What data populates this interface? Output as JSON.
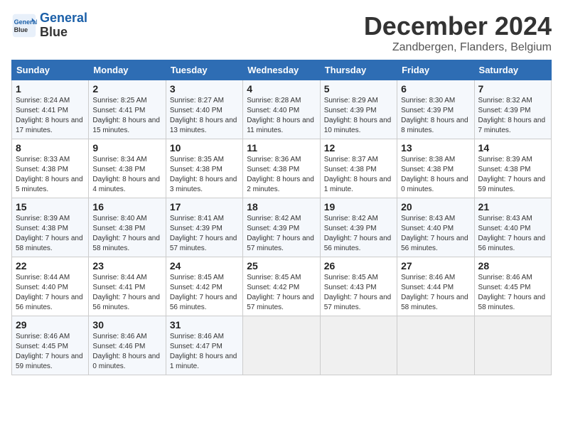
{
  "header": {
    "logo_line1": "General",
    "logo_line2": "Blue",
    "month_title": "December 2024",
    "location": "Zandbergen, Flanders, Belgium"
  },
  "weekdays": [
    "Sunday",
    "Monday",
    "Tuesday",
    "Wednesday",
    "Thursday",
    "Friday",
    "Saturday"
  ],
  "weeks": [
    [
      {
        "day": "1",
        "info": "Sunrise: 8:24 AM\nSunset: 4:41 PM\nDaylight: 8 hours and 17 minutes."
      },
      {
        "day": "2",
        "info": "Sunrise: 8:25 AM\nSunset: 4:41 PM\nDaylight: 8 hours and 15 minutes."
      },
      {
        "day": "3",
        "info": "Sunrise: 8:27 AM\nSunset: 4:40 PM\nDaylight: 8 hours and 13 minutes."
      },
      {
        "day": "4",
        "info": "Sunrise: 8:28 AM\nSunset: 4:40 PM\nDaylight: 8 hours and 11 minutes."
      },
      {
        "day": "5",
        "info": "Sunrise: 8:29 AM\nSunset: 4:39 PM\nDaylight: 8 hours and 10 minutes."
      },
      {
        "day": "6",
        "info": "Sunrise: 8:30 AM\nSunset: 4:39 PM\nDaylight: 8 hours and 8 minutes."
      },
      {
        "day": "7",
        "info": "Sunrise: 8:32 AM\nSunset: 4:39 PM\nDaylight: 8 hours and 7 minutes."
      }
    ],
    [
      {
        "day": "8",
        "info": "Sunrise: 8:33 AM\nSunset: 4:38 PM\nDaylight: 8 hours and 5 minutes."
      },
      {
        "day": "9",
        "info": "Sunrise: 8:34 AM\nSunset: 4:38 PM\nDaylight: 8 hours and 4 minutes."
      },
      {
        "day": "10",
        "info": "Sunrise: 8:35 AM\nSunset: 4:38 PM\nDaylight: 8 hours and 3 minutes."
      },
      {
        "day": "11",
        "info": "Sunrise: 8:36 AM\nSunset: 4:38 PM\nDaylight: 8 hours and 2 minutes."
      },
      {
        "day": "12",
        "info": "Sunrise: 8:37 AM\nSunset: 4:38 PM\nDaylight: 8 hours and 1 minute."
      },
      {
        "day": "13",
        "info": "Sunrise: 8:38 AM\nSunset: 4:38 PM\nDaylight: 8 hours and 0 minutes."
      },
      {
        "day": "14",
        "info": "Sunrise: 8:39 AM\nSunset: 4:38 PM\nDaylight: 7 hours and 59 minutes."
      }
    ],
    [
      {
        "day": "15",
        "info": "Sunrise: 8:39 AM\nSunset: 4:38 PM\nDaylight: 7 hours and 58 minutes."
      },
      {
        "day": "16",
        "info": "Sunrise: 8:40 AM\nSunset: 4:38 PM\nDaylight: 7 hours and 58 minutes."
      },
      {
        "day": "17",
        "info": "Sunrise: 8:41 AM\nSunset: 4:39 PM\nDaylight: 7 hours and 57 minutes."
      },
      {
        "day": "18",
        "info": "Sunrise: 8:42 AM\nSunset: 4:39 PM\nDaylight: 7 hours and 57 minutes."
      },
      {
        "day": "19",
        "info": "Sunrise: 8:42 AM\nSunset: 4:39 PM\nDaylight: 7 hours and 56 minutes."
      },
      {
        "day": "20",
        "info": "Sunrise: 8:43 AM\nSunset: 4:40 PM\nDaylight: 7 hours and 56 minutes."
      },
      {
        "day": "21",
        "info": "Sunrise: 8:43 AM\nSunset: 4:40 PM\nDaylight: 7 hours and 56 minutes."
      }
    ],
    [
      {
        "day": "22",
        "info": "Sunrise: 8:44 AM\nSunset: 4:40 PM\nDaylight: 7 hours and 56 minutes."
      },
      {
        "day": "23",
        "info": "Sunrise: 8:44 AM\nSunset: 4:41 PM\nDaylight: 7 hours and 56 minutes."
      },
      {
        "day": "24",
        "info": "Sunrise: 8:45 AM\nSunset: 4:42 PM\nDaylight: 7 hours and 56 minutes."
      },
      {
        "day": "25",
        "info": "Sunrise: 8:45 AM\nSunset: 4:42 PM\nDaylight: 7 hours and 57 minutes."
      },
      {
        "day": "26",
        "info": "Sunrise: 8:45 AM\nSunset: 4:43 PM\nDaylight: 7 hours and 57 minutes."
      },
      {
        "day": "27",
        "info": "Sunrise: 8:46 AM\nSunset: 4:44 PM\nDaylight: 7 hours and 58 minutes."
      },
      {
        "day": "28",
        "info": "Sunrise: 8:46 AM\nSunset: 4:45 PM\nDaylight: 7 hours and 58 minutes."
      }
    ],
    [
      {
        "day": "29",
        "info": "Sunrise: 8:46 AM\nSunset: 4:45 PM\nDaylight: 7 hours and 59 minutes."
      },
      {
        "day": "30",
        "info": "Sunrise: 8:46 AM\nSunset: 4:46 PM\nDaylight: 8 hours and 0 minutes."
      },
      {
        "day": "31",
        "info": "Sunrise: 8:46 AM\nSunset: 4:47 PM\nDaylight: 8 hours and 1 minute."
      },
      {
        "day": "",
        "info": ""
      },
      {
        "day": "",
        "info": ""
      },
      {
        "day": "",
        "info": ""
      },
      {
        "day": "",
        "info": ""
      }
    ]
  ]
}
